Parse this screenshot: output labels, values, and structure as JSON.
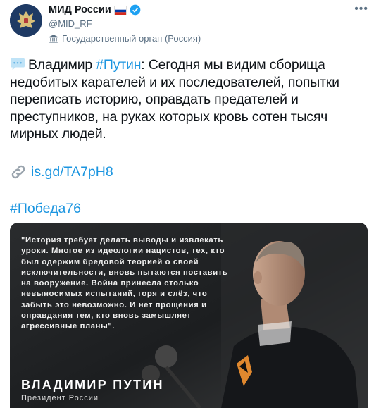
{
  "account": {
    "name": "МИД России",
    "handle": "@MID_RF",
    "label": "Государственный орган (Россия)",
    "flag_colors": [
      "#ffffff",
      "#0039a6",
      "#d52b1e"
    ],
    "verified_color": "#1da1f2"
  },
  "tweet": {
    "speech_icon": "speech-balloon-icon",
    "speaker": "Владимир",
    "hashtag1": "#Путин",
    "text": ": Сегодня мы видим сборища недобитых карателей и их последователей, попытки переписать историю, оправдать предателей и преступников, на руках которых кровь сотен тысяч мирных людей.",
    "link": "is.gd/TA7pH8",
    "hashtag2": "#Победа76"
  },
  "media": {
    "quote": "\"История требует делать выводы и извлекать уроки. Многое из идеологии нацистов, тех, кто был одержим бредовой теорией о своей исключительности, вновь пытаются поставить на вооружение. Война принесла столько невыносимых испытаний, горя и слёз, что забыть это невозможно. И нет прощения и оправдания тем, кто вновь замышляет агрессивные планы\".",
    "speaker_name": "ВЛАДИМИР ПУТИН",
    "speaker_role": "Президент России"
  },
  "colors": {
    "link": "#1b95e0",
    "text": "#0f1419",
    "muted": "#5b7083"
  }
}
